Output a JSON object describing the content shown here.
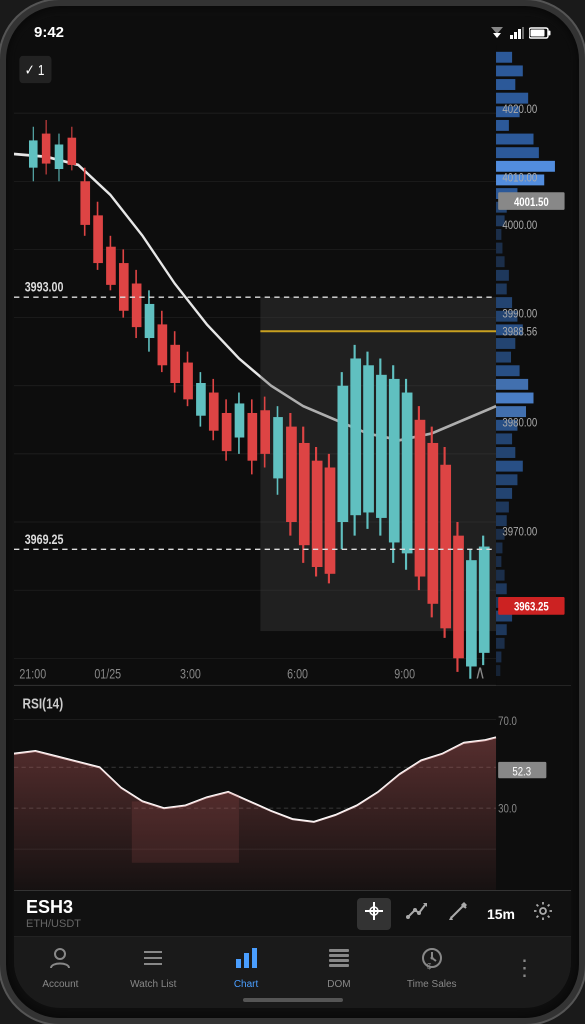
{
  "status": {
    "time": "9:42",
    "wifi_icon": "▼",
    "signal_icon": "▲",
    "battery_icon": "▪"
  },
  "chart": {
    "symbol": "ESH3",
    "sub_symbol": "ETH/USDT",
    "price_levels": {
      "top": "4020.00",
      "p4010": "4010.00",
      "p4001_50": "4001.50",
      "p4000": "4000.00",
      "p3993": "3993.00",
      "p3990": "3990.00",
      "p3988_56": "3988.56",
      "p3980": "3980.00",
      "p3969_25": "3969.25",
      "p3970": "3970.00",
      "current": "3963.25"
    },
    "time_labels": [
      "21:00",
      "01/25",
      "3:00",
      "6:00",
      "9:00"
    ],
    "indicator": "RSI(14)",
    "rsi_levels": {
      "high": "70.0",
      "mid": "52.3",
      "low": "30.0"
    },
    "timeframe": "15m",
    "badge_label": "1"
  },
  "toolbar": {
    "tools": [
      {
        "id": "crosshair",
        "label": "⊕",
        "active": true
      },
      {
        "id": "trend",
        "label": "↗",
        "active": false
      },
      {
        "id": "draw",
        "label": "✏",
        "active": false
      },
      {
        "id": "timeframe",
        "label": "15m",
        "active": false
      },
      {
        "id": "settings",
        "label": "⚙",
        "active": false
      }
    ]
  },
  "nav": {
    "items": [
      {
        "id": "account",
        "label": "Account",
        "active": false,
        "icon": "person"
      },
      {
        "id": "watchlist",
        "label": "Watch List",
        "active": false,
        "icon": "list"
      },
      {
        "id": "chart",
        "label": "Chart",
        "active": true,
        "icon": "chart"
      },
      {
        "id": "dom",
        "label": "DOM",
        "active": false,
        "icon": "dom"
      },
      {
        "id": "timesales",
        "label": "Time Sales",
        "active": false,
        "icon": "clock"
      }
    ],
    "more_icon": "⋮"
  }
}
